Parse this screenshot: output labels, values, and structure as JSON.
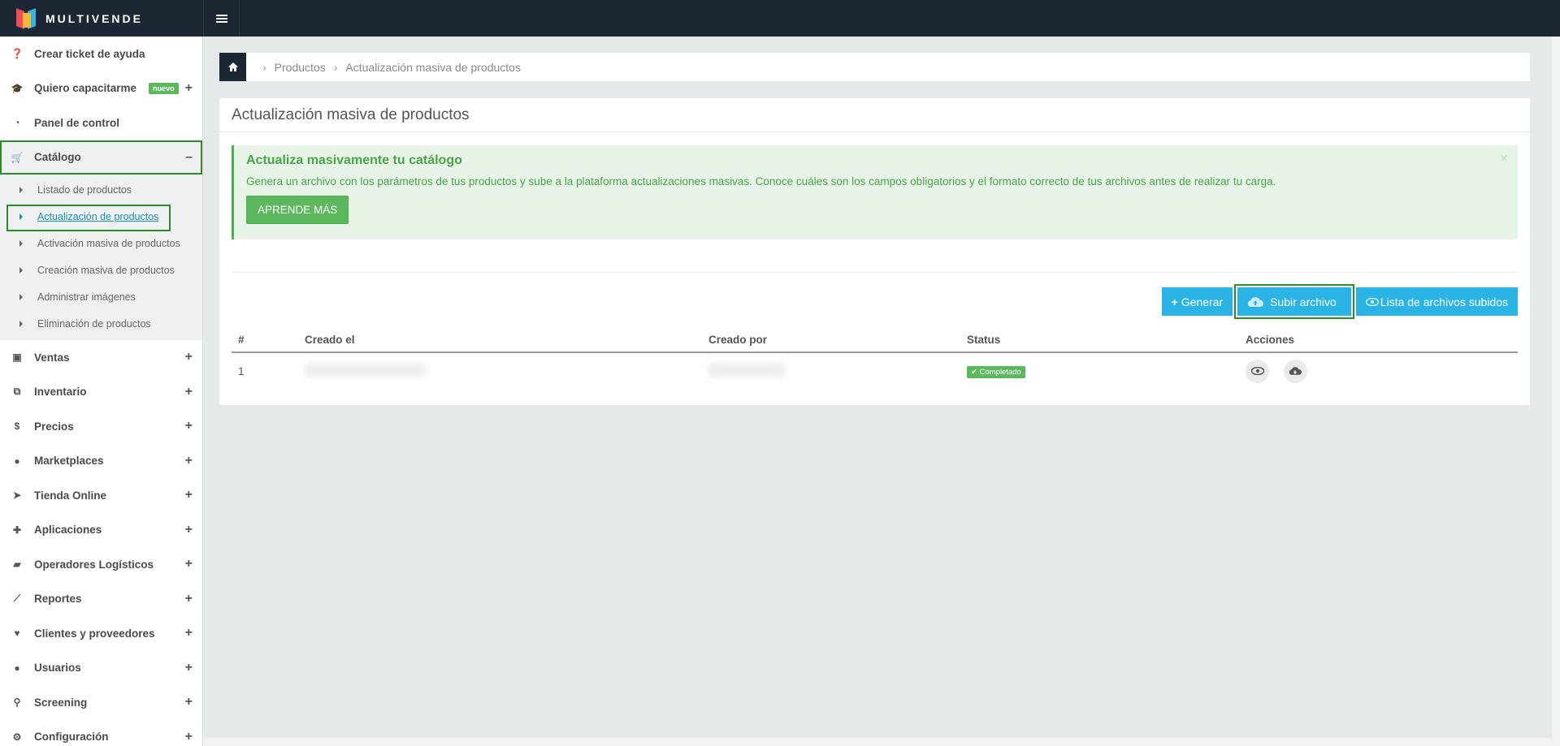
{
  "brand": {
    "name": "MULTIVENDE"
  },
  "sidebar": {
    "items": [
      {
        "label": "Crear ticket de ayuda",
        "icon": "question-circle-icon",
        "glyph": "❓",
        "expand": ""
      },
      {
        "label": "Quiero capacitarme",
        "icon": "graduation-cap-icon",
        "glyph": "🎓",
        "expand": "+",
        "badge": "nuevo"
      },
      {
        "label": "Panel de control",
        "icon": "dashboard-icon",
        "glyph": "◔",
        "expand": ""
      },
      {
        "label": "Catálogo",
        "icon": "cart-icon",
        "glyph": "🛒",
        "expand": "–"
      },
      {
        "label": "Ventas",
        "icon": "money-icon",
        "glyph": "▣",
        "expand": "+"
      },
      {
        "label": "Inventario",
        "icon": "cubes-icon",
        "glyph": "⧉",
        "expand": "+"
      },
      {
        "label": "Precios",
        "icon": "dollar-icon",
        "glyph": "$",
        "expand": "+"
      },
      {
        "label": "Marketplaces",
        "icon": "globe-icon",
        "glyph": "●",
        "expand": "+"
      },
      {
        "label": "Tienda Online",
        "icon": "pointer-icon",
        "glyph": "➤",
        "expand": "+"
      },
      {
        "label": "Aplicaciones",
        "icon": "puzzle-icon",
        "glyph": "✚",
        "expand": "+"
      },
      {
        "label": "Operadores Logísticos",
        "icon": "truck-icon",
        "glyph": "▰",
        "expand": "+"
      },
      {
        "label": "Reportes",
        "icon": "line-chart-icon",
        "glyph": "⟋",
        "expand": "+"
      },
      {
        "label": "Clientes y proveedores",
        "icon": "heart-icon",
        "glyph": "♥",
        "expand": "+"
      },
      {
        "label": "Usuarios",
        "icon": "user-icon",
        "glyph": "●",
        "expand": "+"
      },
      {
        "label": "Screening",
        "icon": "search-icon",
        "glyph": "⚲",
        "expand": "+"
      },
      {
        "label": "Configuración",
        "icon": "gear-icon",
        "glyph": "⚙",
        "expand": "+"
      }
    ],
    "catalog_sub": [
      "Listado de productos",
      "Actualización de productos",
      "Activación masiva de productos",
      "Creación masiva de productos",
      "Administrar imágenes",
      "Eliminación de productos"
    ]
  },
  "breadcrumb": {
    "level1": "Productos",
    "level2": "Actualización masiva de productos"
  },
  "page": {
    "title": "Actualización masiva de productos"
  },
  "alert": {
    "title": "Actualiza masivamente tu catálogo",
    "text": "Genera un archivo con los parámetros de tus productos y sube a la plataforma actualizaciones masivas. Conoce cuáles son los campos obligatorios y el formato correcto de tus archivos antes de realizar tu carga.",
    "button": "APRENDE MÁS",
    "close": "×"
  },
  "actions": {
    "generate": "Generar",
    "upload": "Subir archivo",
    "list": "Lista de archivos subidos"
  },
  "table": {
    "headers": [
      "#",
      "Creado el",
      "Creado por",
      "Status",
      "Acciones"
    ],
    "rows": [
      {
        "num": "1",
        "status": "Completado"
      }
    ]
  },
  "colors": {
    "accent_blue": "#2ab4e6",
    "success_green": "#5cb85c",
    "topbar": "#1c2733"
  }
}
